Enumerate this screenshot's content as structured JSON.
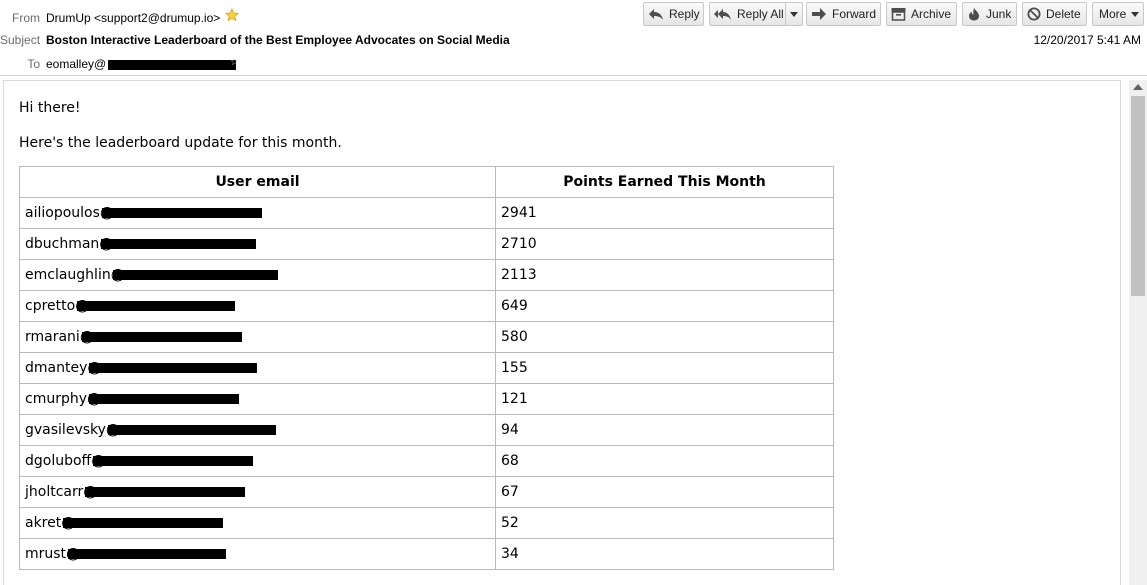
{
  "header": {
    "from_label": "From",
    "from_value": "DrumUp <support2@drumup.io>",
    "subject_label": "Subject",
    "subject_value": "Boston Interactive Leaderboard of the Best Employee Advocates on Social Media",
    "to_label": "To",
    "to_value": "eomalley@",
    "date": "12/20/2017 5:41 AM"
  },
  "toolbar": {
    "reply": "Reply",
    "reply_all": "Reply All",
    "forward": "Forward",
    "archive": "Archive",
    "junk": "Junk",
    "delete": "Delete",
    "more": "More"
  },
  "message": {
    "greeting": "Hi there!",
    "intro": "Here's the leaderboard update for this month.",
    "table": {
      "headers": [
        "User email",
        "Points Earned This Month"
      ],
      "rows": [
        {
          "email": "ailiopoulos@",
          "points": "2941"
        },
        {
          "email": "dbuchman@",
          "points": "2710"
        },
        {
          "email": "emclaughlin@",
          "points": "2113"
        },
        {
          "email": "cpretto@",
          "points": "649"
        },
        {
          "email": "rmarani@",
          "points": "580"
        },
        {
          "email": "dmantey@",
          "points": "155"
        },
        {
          "email": "cmurphy@",
          "points": "121"
        },
        {
          "email": "gvasilevsky@",
          "points": "94"
        },
        {
          "email": "dgoluboff@",
          "points": "68"
        },
        {
          "email": "jholtcarr@",
          "points": "67"
        },
        {
          "email": "akret@",
          "points": "52"
        },
        {
          "email": "mrust@",
          "points": "34"
        }
      ]
    }
  },
  "colors": {
    "redaction": "#000000",
    "border": "#b9b9b9",
    "label": "#6b6b6b",
    "star": "#f2c200"
  }
}
